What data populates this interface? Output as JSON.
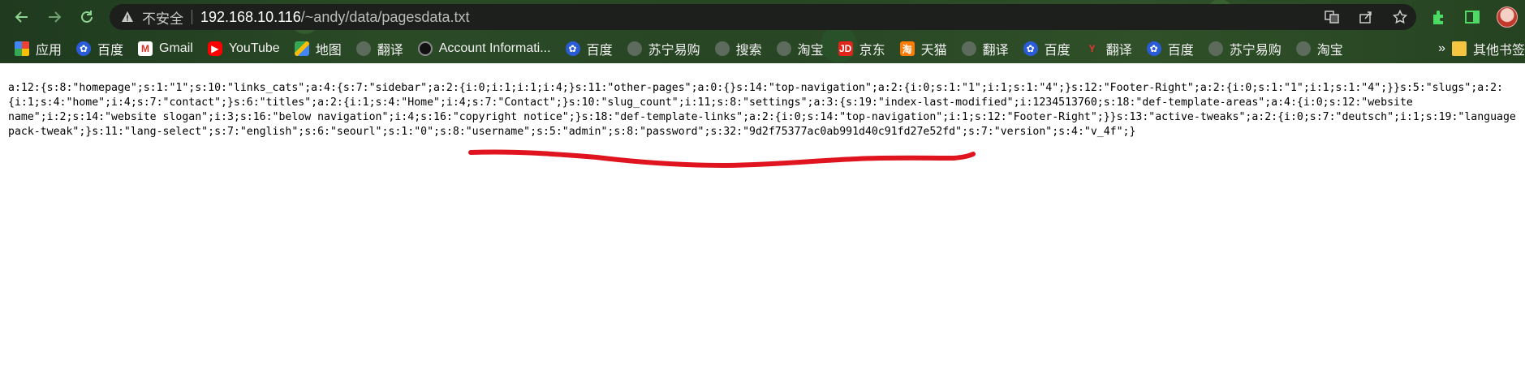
{
  "browser": {
    "security_label": "不安全",
    "url_host": "192.168.10.116",
    "url_path": "/~andy/data/pagesdata.txt",
    "bookmarks": [
      {
        "label": "应用",
        "icon": "apps-grid-icon"
      },
      {
        "label": "百度",
        "icon": "baidu-paw-icon"
      },
      {
        "label": "Gmail",
        "icon": "gmail-icon"
      },
      {
        "label": "YouTube",
        "icon": "youtube-icon"
      },
      {
        "label": "地图",
        "icon": "maps-icon"
      },
      {
        "label": "翻译",
        "icon": "globe-icon"
      },
      {
        "label": "Account Informati...",
        "icon": "account-circle-icon"
      },
      {
        "label": "百度",
        "icon": "baidu-paw-icon"
      },
      {
        "label": "苏宁易购",
        "icon": "globe-icon"
      },
      {
        "label": "搜索",
        "icon": "globe-icon"
      },
      {
        "label": "淘宝",
        "icon": "globe-icon"
      },
      {
        "label": "京东",
        "icon": "jd-icon"
      },
      {
        "label": "天猫",
        "icon": "tmall-icon"
      },
      {
        "label": "翻译",
        "icon": "globe-icon"
      },
      {
        "label": "百度",
        "icon": "baidu-paw-icon"
      },
      {
        "label": "翻译",
        "icon": "translate-red-icon"
      },
      {
        "label": "百度",
        "icon": "baidu-paw-icon"
      },
      {
        "label": "苏宁易购",
        "icon": "globe-icon"
      },
      {
        "label": "淘宝",
        "icon": "globe-icon"
      }
    ],
    "more_label": "»",
    "other_bookmarks": "其他书签"
  },
  "document": {
    "lines": [
      "a:12:{s:8:\"homepage\";s:1:\"1\";s:10:\"links_cats\";a:4:{s:7:\"sidebar\";a:2:{i:0;i:1;i:1;i:4;}s:11:\"other-pages\";a:0:{}s:14:\"top-navigation\";a:2:{i:0;s:1:\"1\";i:1;s:1:\"4\";}s:12:\"Footer-Right\";a:2:{i:0;s:1:\"1\";i:1;s:1:\"4\";}}s:5:\"slugs\";a:2:",
      "{i:1;s:4:\"home\";i:4;s:7:\"contact\";}s:6:\"titles\";a:2:{i:1;s:4:\"Home\";i:4;s:7:\"Contact\";}s:10:\"slug_count\";i:11;s:8:\"settings\";a:3:{s:19:\"index-last-modified\";i:1234513760;s:18:\"def-template-areas\";a:4:{i:0;s:12:\"website",
      "name\";i:2;s:14:\"website slogan\";i:3;s:16:\"below navigation\";i:4;s:16:\"copyright notice\";}s:18:\"def-template-links\";a:2:{i:0;s:14:\"top-navigation\";i:1;s:12:\"Footer-Right\";}}s:13:\"active-tweaks\";a:2:{i:0;s:7:\"deutsch\";i:1;s:19:\"language",
      "pack-tweak\";}s:11:\"lang-select\";s:7:\"english\";s:6:\"seourl\";s:1:\"0\";s:8:\"username\";s:5:\"admin\";s:8:\"password\";s:32:\"9d2f75377ac0ab991d40c91fd27e52fd\";s:7:\"version\";s:4:\"v_4f\";}"
    ]
  },
  "colors": {
    "annotation_stroke": "#e0141e",
    "omnibox_bg": "#1c1f1c"
  }
}
